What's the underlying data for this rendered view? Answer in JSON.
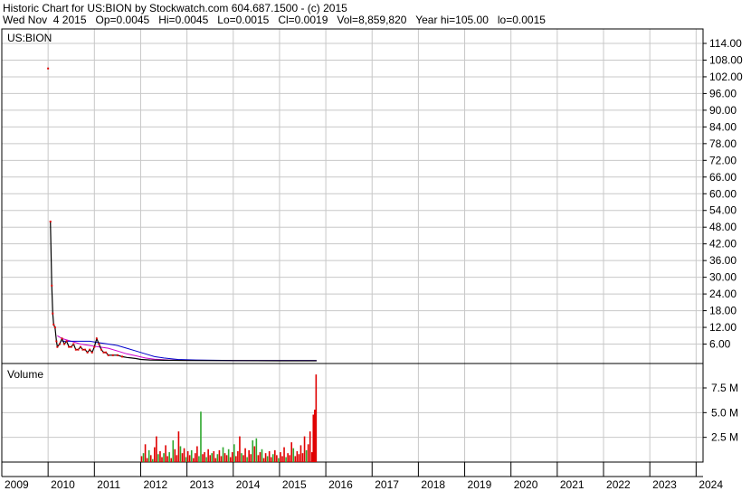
{
  "header": {
    "line1": "Historic Chart for US:BION by Stockwatch.com 604.687.1500 - (c) 2015",
    "line2": "Wed Nov  4 2015   Op=0.0045   Hi=0.0045   Lo=0.0015   Cl=0.0019   Vol=8,859,820   Year hi=105.00   lo=0.0015"
  },
  "colors": {
    "up": "#2ea82e",
    "down": "#e00000",
    "ma_short": "#cc00cc",
    "ma_long": "#0000cc",
    "price": "#000000",
    "grid": "#c8c8c8"
  },
  "chart_data": [
    {
      "type": "line",
      "symbol_label": "US:BION",
      "y_ticks": [
        "114.00",
        "108.00",
        "102.00",
        "96.00",
        "90.00",
        "84.00",
        "78.00",
        "72.00",
        "66.00",
        "60.00",
        "54.00",
        "48.00",
        "42.00",
        "36.00",
        "30.00",
        "24.00",
        "18.00",
        "12.00",
        "6.00"
      ],
      "ylim": [
        0,
        118
      ],
      "x_ticks": [
        "2009",
        "2010",
        "2011",
        "2012",
        "2013",
        "2014",
        "2015",
        "2016",
        "2017",
        "2018",
        "2019",
        "2020",
        "2021",
        "2022",
        "2023",
        "2024"
      ],
      "xlim": [
        2009.0,
        2024.15
      ],
      "series": [
        {
          "x": [
            2010.05,
            2010.08,
            2010.1,
            2010.12,
            2010.15,
            2010.18,
            2010.2,
            2010.25,
            2010.3,
            2010.35,
            2010.4,
            2010.45,
            2010.5,
            2010.55,
            2010.6,
            2010.65,
            2010.7,
            2010.75,
            2010.8,
            2010.85,
            2010.9,
            2010.95,
            2011.0,
            2011.05,
            2011.1,
            2011.15,
            2011.2,
            2011.25,
            2011.3,
            2011.4,
            2011.5,
            2011.6,
            2011.7,
            2011.8,
            2011.9,
            2012.0,
            2012.2,
            2012.5,
            2013.0,
            2014.0,
            2015.0,
            2015.8
          ],
          "values": [
            50,
            27,
            17,
            13,
            12,
            7,
            5,
            6,
            8,
            6,
            7,
            5,
            5,
            6,
            4,
            4,
            5,
            4,
            4,
            3,
            4,
            3,
            5,
            8,
            6,
            4,
            3,
            3,
            2,
            2,
            2,
            1.5,
            1.2,
            1,
            0.8,
            0.5,
            0.3,
            0.2,
            0.1,
            0.05,
            0.01,
            0.002
          ]
        }
      ],
      "ma_series": [
        {
          "x": [
            2010.2,
            2010.3,
            2010.5,
            2010.7,
            2010.9,
            2011.1,
            2011.3,
            2011.5,
            2011.7,
            2011.9,
            2012.1,
            2012.3,
            2012.6,
            2013.0,
            2014.0,
            2015.8
          ],
          "values": [
            9,
            8,
            7,
            6,
            5.5,
            5,
            4.5,
            3.5,
            2.5,
            1.8,
            1,
            0.6,
            0.3,
            0.2,
            0.1,
            0.05
          ]
        },
        {
          "x": [
            2010.3,
            2010.5,
            2010.7,
            2010.9,
            2011.1,
            2011.3,
            2011.5,
            2011.7,
            2011.9,
            2012.1,
            2012.3,
            2012.5,
            2012.8,
            2013.2,
            2014.0,
            2015.8
          ],
          "values": [
            7,
            7,
            7,
            7,
            6.5,
            6,
            5.5,
            4.5,
            3.5,
            2.5,
            1.5,
            1,
            0.5,
            0.3,
            0.1,
            0.05
          ]
        }
      ],
      "annotations": [
        {
          "x": 2010.0,
          "value": 105
        }
      ]
    },
    {
      "type": "bar",
      "panel_label": "Volume",
      "y_ticks": [
        "7.5 M",
        "5.0 M",
        "2.5 M"
      ],
      "ylim": [
        0,
        10000000
      ],
      "xlim": [
        2009.0,
        2024.15
      ],
      "note": "daily volume bars, 2012.0 to 2015.8",
      "bars": [
        {
          "x": 2012.02,
          "v": 600000,
          "up": false
        },
        {
          "x": 2012.06,
          "v": 900000,
          "up": true
        },
        {
          "x": 2012.1,
          "v": 1800000,
          "up": false
        },
        {
          "x": 2012.14,
          "v": 400000,
          "up": false
        },
        {
          "x": 2012.18,
          "v": 1200000,
          "up": true
        },
        {
          "x": 2012.22,
          "v": 700000,
          "up": false
        },
        {
          "x": 2012.26,
          "v": 300000,
          "up": true
        },
        {
          "x": 2012.3,
          "v": 1500000,
          "up": false
        },
        {
          "x": 2012.34,
          "v": 2600000,
          "up": false
        },
        {
          "x": 2012.38,
          "v": 800000,
          "up": true
        },
        {
          "x": 2012.42,
          "v": 1100000,
          "up": false
        },
        {
          "x": 2012.46,
          "v": 500000,
          "up": false
        },
        {
          "x": 2012.5,
          "v": 900000,
          "up": true
        },
        {
          "x": 2012.54,
          "v": 1700000,
          "up": false
        },
        {
          "x": 2012.58,
          "v": 600000,
          "up": false
        },
        {
          "x": 2012.62,
          "v": 1000000,
          "up": true
        },
        {
          "x": 2012.66,
          "v": 400000,
          "up": false
        },
        {
          "x": 2012.7,
          "v": 2200000,
          "up": true
        },
        {
          "x": 2012.74,
          "v": 1300000,
          "up": false
        },
        {
          "x": 2012.78,
          "v": 700000,
          "up": false
        },
        {
          "x": 2012.82,
          "v": 3100000,
          "up": false
        },
        {
          "x": 2012.86,
          "v": 1600000,
          "up": true
        },
        {
          "x": 2012.9,
          "v": 900000,
          "up": false
        },
        {
          "x": 2012.94,
          "v": 1400000,
          "up": false
        },
        {
          "x": 2012.98,
          "v": 500000,
          "up": true
        },
        {
          "x": 2013.02,
          "v": 1100000,
          "up": false
        },
        {
          "x": 2013.06,
          "v": 700000,
          "up": false
        },
        {
          "x": 2013.1,
          "v": 1200000,
          "up": true
        },
        {
          "x": 2013.14,
          "v": 400000,
          "up": false
        },
        {
          "x": 2013.18,
          "v": 900000,
          "up": false
        },
        {
          "x": 2013.22,
          "v": 1600000,
          "up": false
        },
        {
          "x": 2013.26,
          "v": 600000,
          "up": true
        },
        {
          "x": 2013.3,
          "v": 5100000,
          "up": true
        },
        {
          "x": 2013.34,
          "v": 800000,
          "up": false
        },
        {
          "x": 2013.38,
          "v": 1000000,
          "up": false
        },
        {
          "x": 2013.42,
          "v": 500000,
          "up": true
        },
        {
          "x": 2013.46,
          "v": 1300000,
          "up": false
        },
        {
          "x": 2013.5,
          "v": 700000,
          "up": false
        },
        {
          "x": 2013.54,
          "v": 900000,
          "up": true
        },
        {
          "x": 2013.58,
          "v": 1100000,
          "up": false
        },
        {
          "x": 2013.62,
          "v": 400000,
          "up": false
        },
        {
          "x": 2013.66,
          "v": 800000,
          "up": true
        },
        {
          "x": 2013.7,
          "v": 1200000,
          "up": false
        },
        {
          "x": 2013.74,
          "v": 600000,
          "up": false
        },
        {
          "x": 2013.78,
          "v": 1500000,
          "up": true
        },
        {
          "x": 2013.82,
          "v": 900000,
          "up": false
        },
        {
          "x": 2013.86,
          "v": 700000,
          "up": false
        },
        {
          "x": 2013.9,
          "v": 1300000,
          "up": true
        },
        {
          "x": 2013.94,
          "v": 500000,
          "up": false
        },
        {
          "x": 2013.98,
          "v": 1000000,
          "up": false
        },
        {
          "x": 2014.02,
          "v": 1800000,
          "up": true
        },
        {
          "x": 2014.06,
          "v": 600000,
          "up": false
        },
        {
          "x": 2014.1,
          "v": 1100000,
          "up": false
        },
        {
          "x": 2014.14,
          "v": 2600000,
          "up": false
        },
        {
          "x": 2014.18,
          "v": 900000,
          "up": true
        },
        {
          "x": 2014.22,
          "v": 700000,
          "up": false
        },
        {
          "x": 2014.26,
          "v": 1400000,
          "up": false
        },
        {
          "x": 2014.3,
          "v": 500000,
          "up": true
        },
        {
          "x": 2014.34,
          "v": 1200000,
          "up": false
        },
        {
          "x": 2014.38,
          "v": 800000,
          "up": false
        },
        {
          "x": 2014.42,
          "v": 2200000,
          "up": true
        },
        {
          "x": 2014.46,
          "v": 1600000,
          "up": false
        },
        {
          "x": 2014.5,
          "v": 2400000,
          "up": true
        },
        {
          "x": 2014.54,
          "v": 700000,
          "up": false
        },
        {
          "x": 2014.58,
          "v": 1000000,
          "up": false
        },
        {
          "x": 2014.62,
          "v": 1300000,
          "up": true
        },
        {
          "x": 2014.66,
          "v": 400000,
          "up": false
        },
        {
          "x": 2014.7,
          "v": 900000,
          "up": false
        },
        {
          "x": 2014.74,
          "v": 600000,
          "up": true
        },
        {
          "x": 2014.78,
          "v": 1100000,
          "up": false
        },
        {
          "x": 2014.82,
          "v": 500000,
          "up": false
        },
        {
          "x": 2014.86,
          "v": 800000,
          "up": true
        },
        {
          "x": 2014.9,
          "v": 1200000,
          "up": false
        },
        {
          "x": 2014.94,
          "v": 700000,
          "up": false
        },
        {
          "x": 2014.98,
          "v": 400000,
          "up": true
        },
        {
          "x": 2015.02,
          "v": 1000000,
          "up": false
        },
        {
          "x": 2015.06,
          "v": 600000,
          "up": false
        },
        {
          "x": 2015.1,
          "v": 1500000,
          "up": false
        },
        {
          "x": 2015.14,
          "v": 500000,
          "up": true
        },
        {
          "x": 2015.18,
          "v": 900000,
          "up": false
        },
        {
          "x": 2015.22,
          "v": 700000,
          "up": false
        },
        {
          "x": 2015.26,
          "v": 2000000,
          "up": false
        },
        {
          "x": 2015.3,
          "v": 1400000,
          "up": true
        },
        {
          "x": 2015.34,
          "v": 600000,
          "up": false
        },
        {
          "x": 2015.38,
          "v": 1100000,
          "up": false
        },
        {
          "x": 2015.42,
          "v": 800000,
          "up": false
        },
        {
          "x": 2015.46,
          "v": 1700000,
          "up": false
        },
        {
          "x": 2015.5,
          "v": 900000,
          "up": false
        },
        {
          "x": 2015.54,
          "v": 2600000,
          "up": false
        },
        {
          "x": 2015.58,
          "v": 1200000,
          "up": true
        },
        {
          "x": 2015.62,
          "v": 1800000,
          "up": false
        },
        {
          "x": 2015.66,
          "v": 3100000,
          "up": false
        },
        {
          "x": 2015.7,
          "v": 1000000,
          "up": false
        },
        {
          "x": 2015.73,
          "v": 4800000,
          "up": false
        },
        {
          "x": 2015.76,
          "v": 5300000,
          "up": false
        },
        {
          "x": 2015.79,
          "v": 8859820,
          "up": false
        }
      ]
    }
  ]
}
